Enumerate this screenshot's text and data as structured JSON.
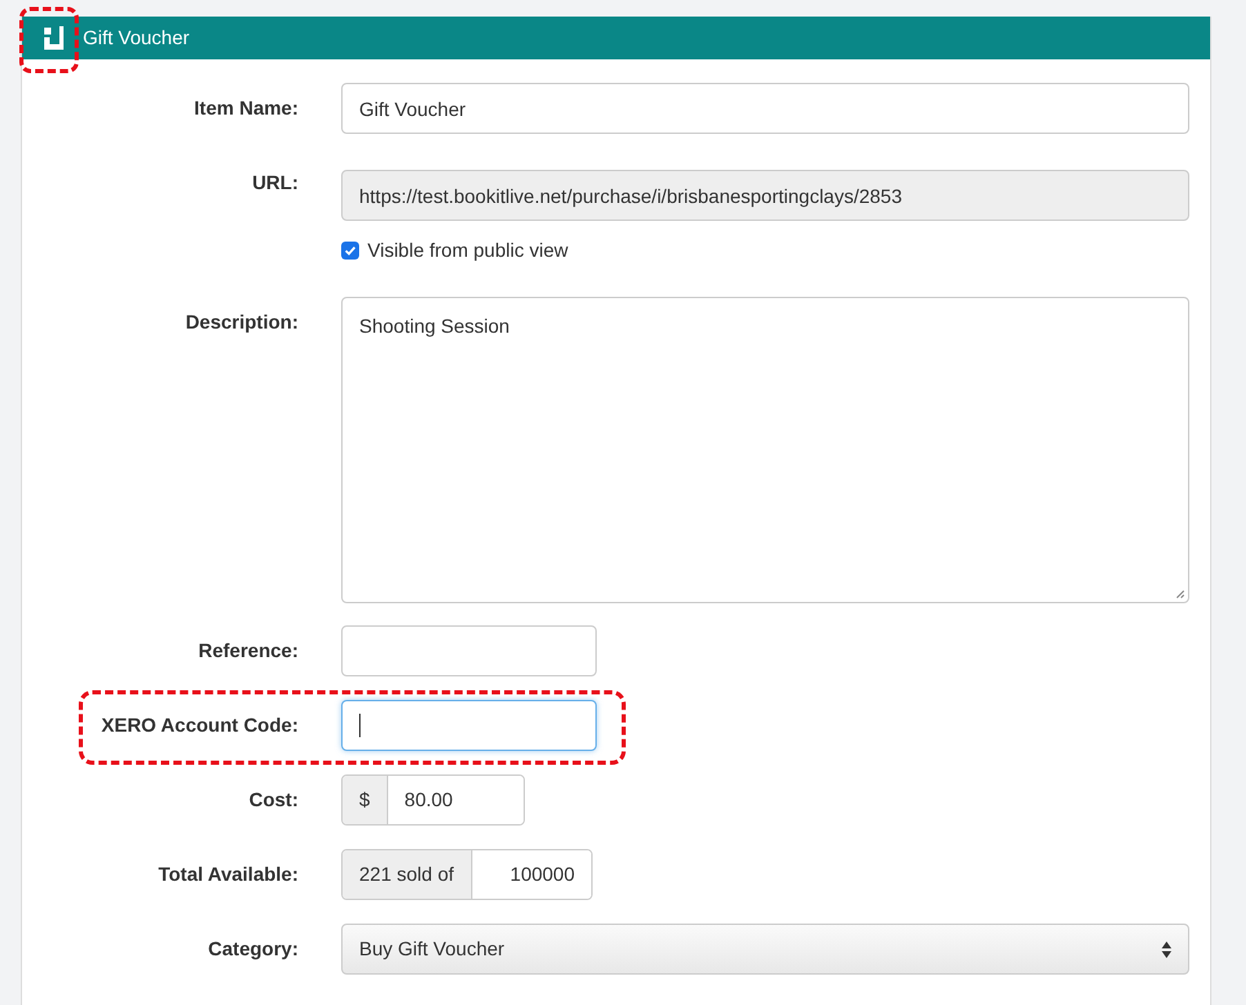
{
  "panel": {
    "title": "Gift Voucher",
    "icon_highlighted": true
  },
  "fields": [
    {
      "kind": "text",
      "label": "Item Name:",
      "value": "Gift Voucher"
    },
    {
      "kind": "readonly",
      "label": "URL:",
      "value": "https://test.bookitlive.net/purchase/i/brisbanesportingclays/2853",
      "checkbox": {
        "label": "Visible from public view",
        "checked": true
      }
    },
    {
      "kind": "textarea",
      "label": "Description:",
      "value": "Shooting Session"
    },
    {
      "kind": "short",
      "label": "Reference:",
      "focused": false
    },
    {
      "kind": "short",
      "label": "XERO Account Code:",
      "focused": true,
      "highlighted": true
    },
    {
      "kind": "addon",
      "label": "Cost:",
      "addon": "$",
      "value": "80.00"
    },
    {
      "kind": "addon_wide",
      "label": "Total Available:",
      "addon": "221 sold of",
      "value": "100000"
    },
    {
      "kind": "select",
      "label": "Category:",
      "value": "Buy Gift Voucher"
    }
  ]
}
